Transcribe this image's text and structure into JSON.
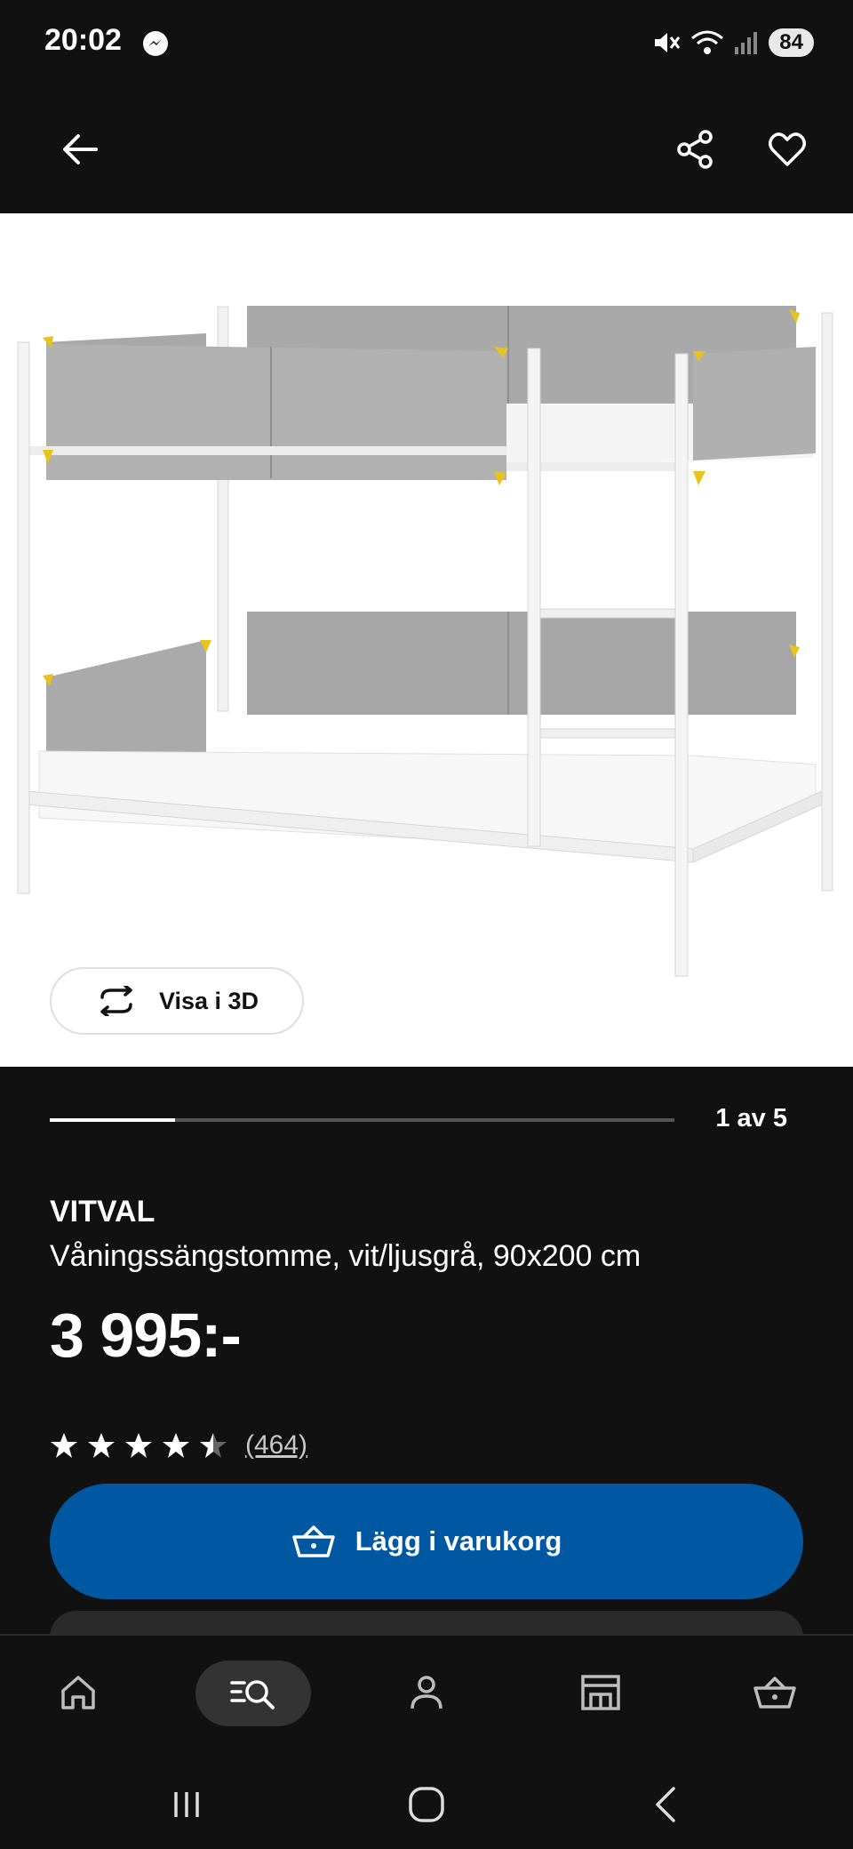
{
  "status_bar": {
    "time": "20:02",
    "battery": "84",
    "icons": [
      "messenger-icon",
      "mute-icon",
      "wifi-icon",
      "signal-icon"
    ]
  },
  "top_bar": {
    "icons": [
      "back-arrow-icon",
      "share-icon",
      "heart-icon"
    ]
  },
  "product_image": {
    "view_3d_label": "Visa i 3D",
    "page_indicator": "1 av 5",
    "progress": 0.2
  },
  "product": {
    "name": "VITVAL",
    "description": "Våningssängstomme, vit/ljusgrå, 90x200 cm",
    "price": "3 995:-",
    "rating": 4.5,
    "review_count": "(464)"
  },
  "cart_button": {
    "label": "Lägg i varukorg"
  },
  "bottom_nav": {
    "items": [
      "home-icon",
      "search-icon",
      "profile-icon",
      "store-icon",
      "cart-icon"
    ],
    "active": "search-icon"
  },
  "colors": {
    "background": "#111111",
    "primary_blue": "#0058a3",
    "image_bg": "#ffffff"
  }
}
